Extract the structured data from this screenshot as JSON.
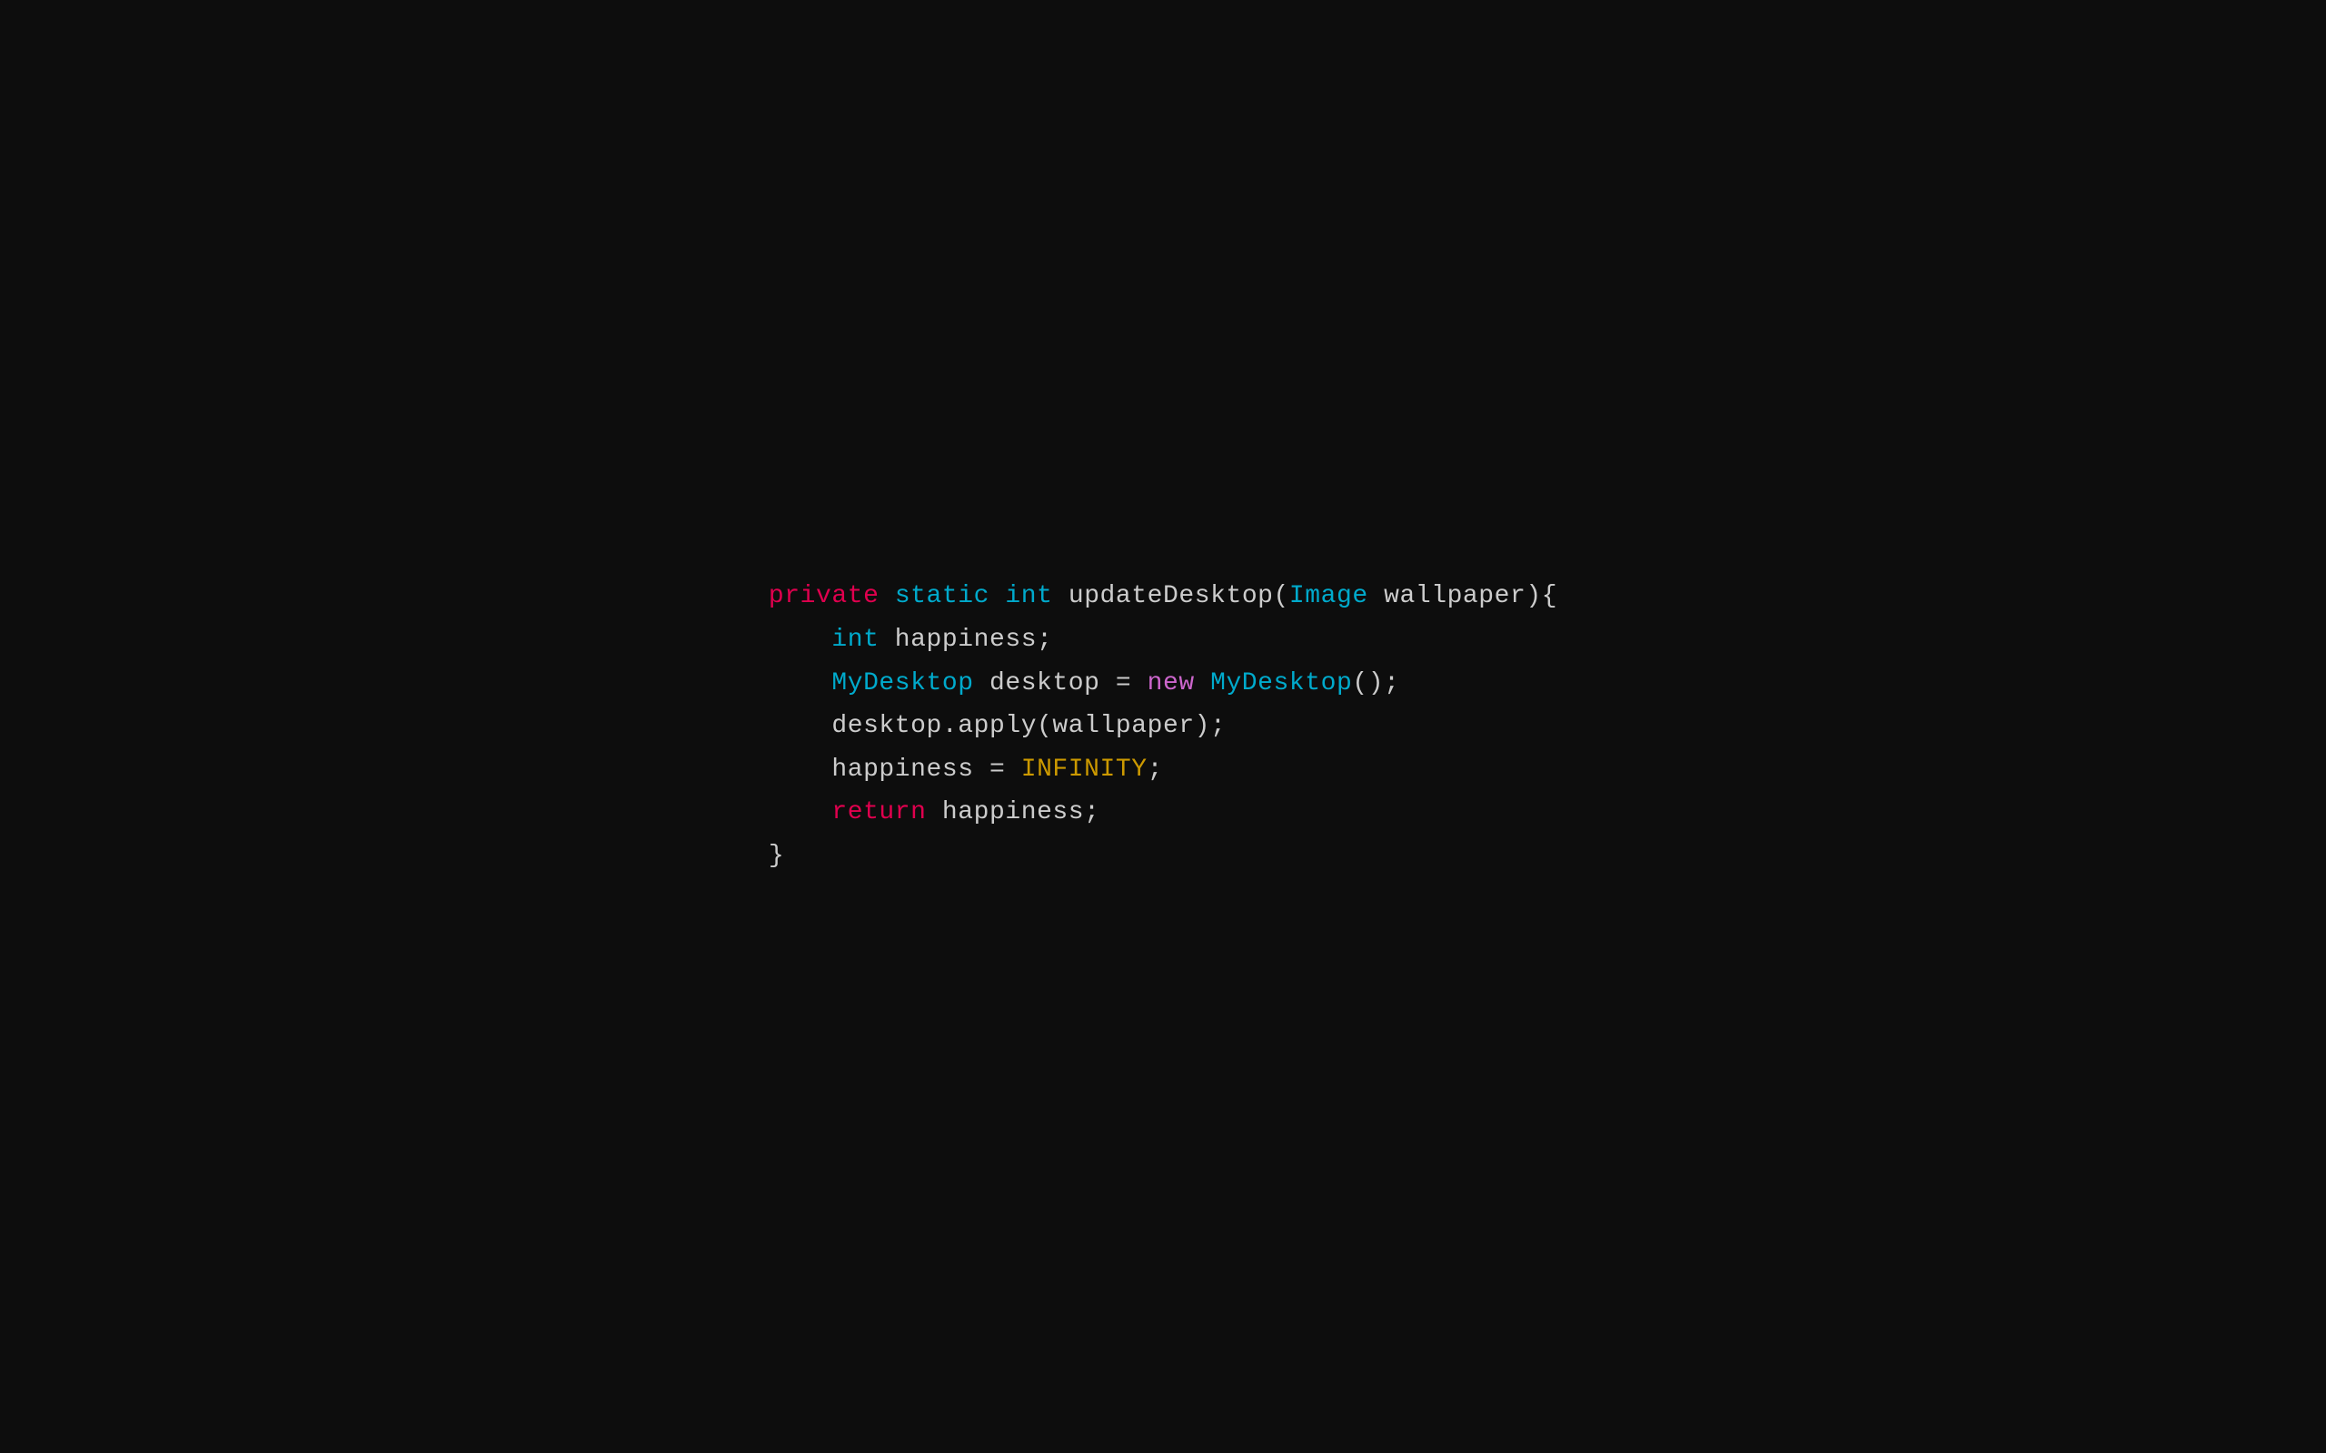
{
  "code": {
    "lines": [
      {
        "id": "line1",
        "parts": [
          {
            "text": "private",
            "cls": "keyword-private"
          },
          {
            "text": " ",
            "cls": "plain"
          },
          {
            "text": "static",
            "cls": "keyword-static"
          },
          {
            "text": " ",
            "cls": "plain"
          },
          {
            "text": "int",
            "cls": "keyword-int"
          },
          {
            "text": " updateDesktop(",
            "cls": "plain"
          },
          {
            "text": "Image",
            "cls": "class-name"
          },
          {
            "text": " wallpaper){",
            "cls": "plain"
          }
        ]
      },
      {
        "id": "line2",
        "parts": [
          {
            "text": "    ",
            "cls": "plain"
          },
          {
            "text": "int",
            "cls": "keyword-int"
          },
          {
            "text": " happiness;",
            "cls": "plain"
          }
        ]
      },
      {
        "id": "line3",
        "parts": [
          {
            "text": "    ",
            "cls": "plain"
          },
          {
            "text": "MyDesktop",
            "cls": "class-name"
          },
          {
            "text": " desktop = ",
            "cls": "plain"
          },
          {
            "text": "new",
            "cls": "keyword-new"
          },
          {
            "text": " ",
            "cls": "plain"
          },
          {
            "text": "MyDesktop",
            "cls": "class-name"
          },
          {
            "text": "();",
            "cls": "plain"
          }
        ]
      },
      {
        "id": "line4",
        "parts": [
          {
            "text": "    desktop.apply(wallpaper);",
            "cls": "plain"
          }
        ]
      },
      {
        "id": "line5",
        "parts": [
          {
            "text": "    happiness = ",
            "cls": "plain"
          },
          {
            "text": "INFINITY",
            "cls": "constant"
          },
          {
            "text": ";",
            "cls": "plain"
          }
        ]
      },
      {
        "id": "line6",
        "parts": [
          {
            "text": "    ",
            "cls": "plain"
          },
          {
            "text": "return",
            "cls": "keyword-return"
          },
          {
            "text": " happiness;",
            "cls": "plain"
          }
        ]
      },
      {
        "id": "line7",
        "parts": [
          {
            "text": "}",
            "cls": "plain"
          }
        ]
      }
    ]
  }
}
